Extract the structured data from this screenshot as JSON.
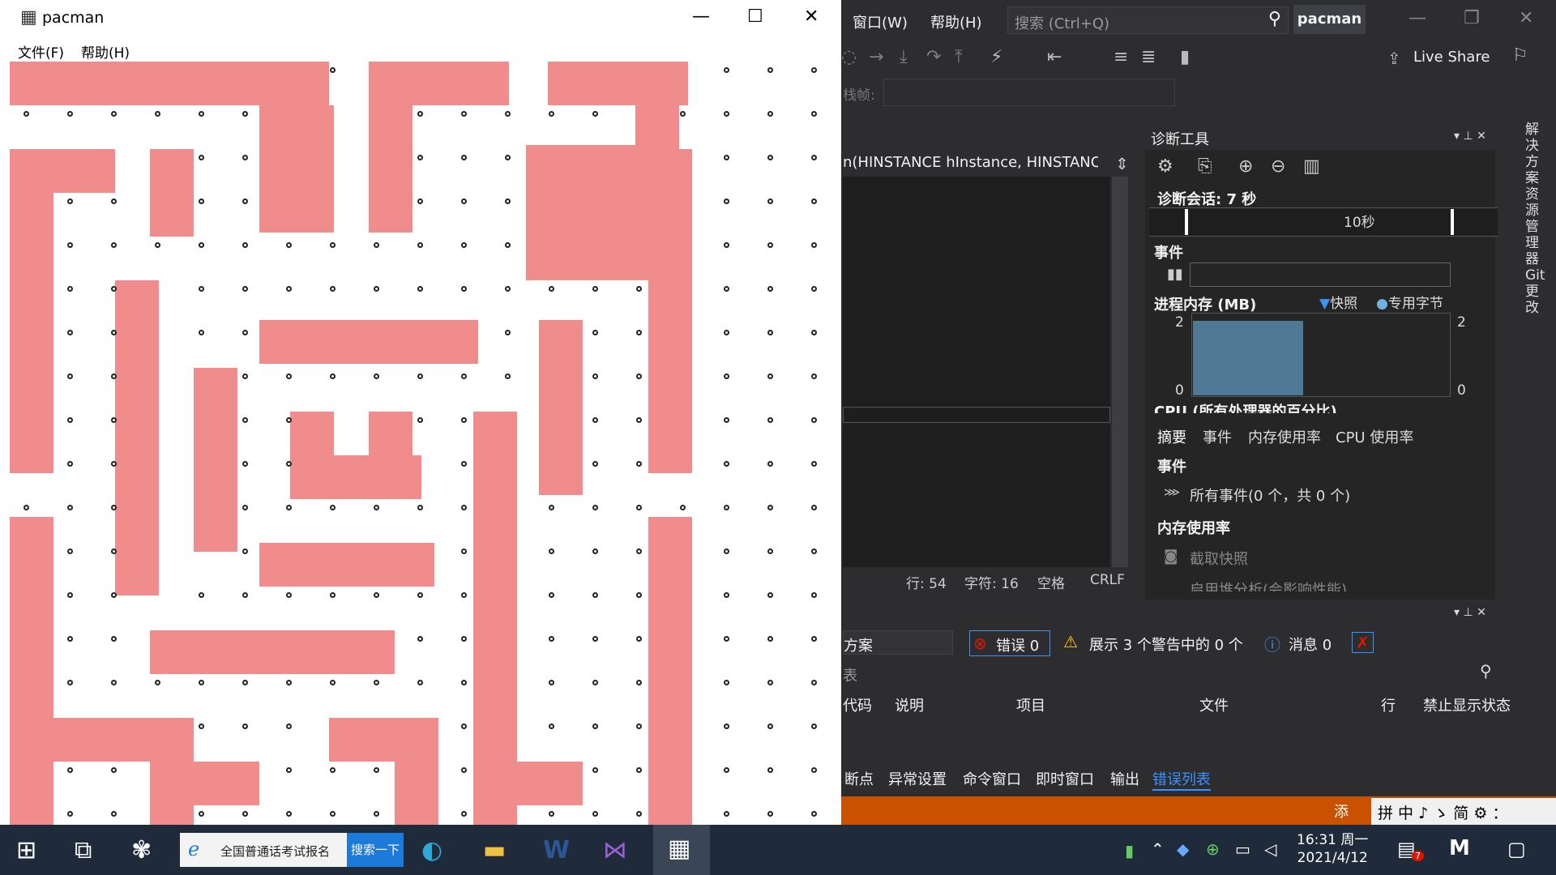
{
  "pacman_window": {
    "title": "pacman",
    "menu": [
      "文件(F)",
      "帮助(H)"
    ],
    "colors": {
      "wall": "#f08c8c",
      "background": "#ffffff",
      "pellet": "#222222"
    }
  },
  "vs": {
    "menu": [
      "窗口(W)",
      "帮助(H)"
    ],
    "search_placeholder": "搜索 (Ctrl+Q)",
    "solution_name": "pacman",
    "live_share": "Live Share",
    "stack_frame_label": "栈帧:",
    "editor_signature": "n(HINSTANCE hInstance, HINSTANCE",
    "status": {
      "line": "行: 54",
      "char": "字符: 16",
      "spaces": "空格",
      "eol": "CRLF"
    },
    "right_rail": [
      "解决方案资源管理器",
      "Git 更改"
    ],
    "diagnostics": {
      "title": "诊断工具",
      "session": "诊断会话: 7 秒",
      "timeline_label": "10秒",
      "events_header": "事件",
      "memory_header": "进程内存 (MB)",
      "legend": [
        "快照",
        "专用字节"
      ],
      "mem_axis": {
        "left_top": "2",
        "left_bottom": "0",
        "right_top": "2",
        "right_bottom": "0"
      },
      "cpu_header": "CPU (所有处理器的百分比)",
      "tabs": [
        "摘要",
        "事件",
        "内存使用率",
        "CPU 使用率"
      ],
      "summary_events": "事件",
      "all_events": "所有事件(0 个，共 0 个)",
      "memory_usage": "内存使用率",
      "snapshot": "截取快照",
      "heap": "启用堆分析(会影响性能)"
    },
    "error_list": {
      "scope": "方案",
      "errors": "错误 0",
      "warnings": "展示 3 个警告中的 0 个",
      "messages": "消息 0",
      "search": "表",
      "columns": [
        "代码",
        "说明",
        "项目",
        "文件",
        "行",
        "禁止显示状态"
      ],
      "bottom_tabs": [
        "断点",
        "异常设置",
        "命令窗口",
        "即时窗口",
        "输出",
        "错误列表"
      ]
    },
    "status_add": "添",
    "ime": "拼 中 ♪ ゝ 简 ⚙ ："
  },
  "taskbar": {
    "search_text": "全国普通话考试报名",
    "search_button": "搜索一下",
    "time": "16:31 周一",
    "date": "2021/4/12",
    "notification_count": "7"
  }
}
